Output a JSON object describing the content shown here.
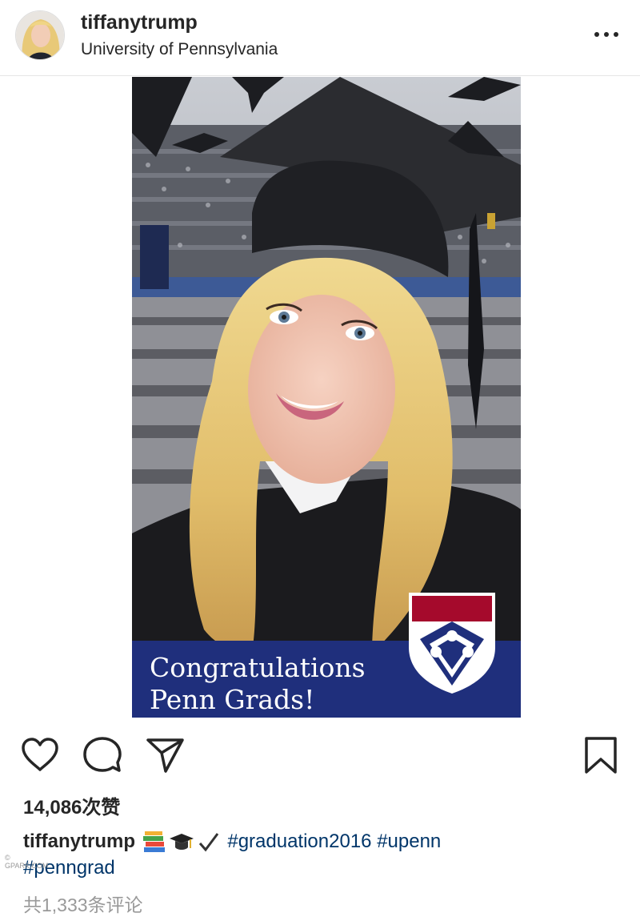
{
  "post": {
    "username": "tiffanytrump",
    "location": "University of Pennsylvania",
    "likes": "14,086次赞",
    "caption_user": "tiffanytrump",
    "caption_emojis": [
      "books-emoji",
      "graduation-cap-emoji",
      "check-mark-emoji"
    ],
    "hashtags": [
      "#graduation2016",
      "#upenn",
      "#penngrad"
    ],
    "comments_link": "共1,333条评论"
  },
  "photo": {
    "banner_line1": "Congratulations",
    "banner_line2": "Penn Grads!"
  },
  "watermark": {
    "line1": "©    ",
    "line2": "GPARK.COM"
  },
  "colors": {
    "hashtag": "#003569",
    "banner": "#1f2f7c",
    "crest_red": "#a50a2c",
    "muted": "#999999"
  },
  "icons": {
    "like": "heart-icon",
    "comment": "comment-icon",
    "share": "paper-plane-icon",
    "save": "bookmark-icon",
    "more": "more-options-icon"
  }
}
